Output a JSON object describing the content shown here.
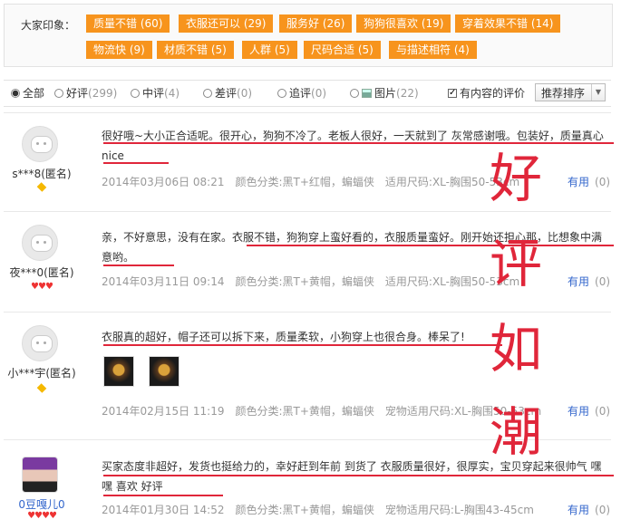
{
  "impression": {
    "label": "大家印象：",
    "tags": [
      "质量不错 (60)",
      "衣服还可以 (29)",
      "服务好 (26)",
      "狗狗很喜欢 (19)",
      "穿着效果不错 (14)",
      "物流快 (9)",
      "材质不错 (5)",
      "人群 (5)",
      "尺码合适 (5)",
      "与描述相符 (4)"
    ]
  },
  "filters": {
    "all": "全部",
    "good": "好评",
    "good_count": "(299)",
    "mid": "中评",
    "mid_count": "(4)",
    "bad": "差评",
    "bad_count": "(0)",
    "append": "追评",
    "append_count": "(0)",
    "pics": "图片",
    "pics_count": "(22)",
    "has_content": "有内容的评价",
    "sort": "推荐排序"
  },
  "reviews": [
    {
      "user": "s***8(匿名)",
      "content": "很好哦~大小正合适呢。很开心，狗狗不冷了。老板人很好，一天就到了 灰常感谢哦。包装好，质量真心nice",
      "date": "2014年03月06日 08:21",
      "color": "颜色分类:黑T+红帽，蝙蝠侠",
      "size": "适用尺码:XL-胸围50-53cm",
      "useful": "有用",
      "useful_count": "(0)"
    },
    {
      "user": "夜***0(匿名)",
      "content": "亲，不好意思，没有在家。衣服不错，狗狗穿上蛮好看的，衣服质量蛮好。刚开始还担心那，比想象中满意哟。",
      "date": "2014年03月11日 09:14",
      "color": "颜色分类:黑T+黄帽，蝙蝠侠",
      "size": "适用尺码:XL-胸围50-53cm",
      "useful": "有用",
      "useful_count": "(0)"
    },
    {
      "user": "小***宇(匿名)",
      "content": "衣服真的超好，帽子还可以拆下来，质量柔软，小狗穿上也很合身。棒呆了!",
      "date": "2014年02月15日 11:19",
      "color": "颜色分类:黑T+黄帽，蝙蝠侠",
      "size": "宠物适用尺码:XL-胸围50-53cm",
      "useful": "有用",
      "useful_count": "(0)"
    },
    {
      "user": "0豆嘎儿0",
      "content": "买家态度非超好，发货也挺给力的，幸好赶到年前 到货了 衣服质量很好，很厚实，宝贝穿起来很帅气 嘿嘿 喜欢 好评",
      "date": "2014年01月30日 14:52",
      "color": "颜色分类:黑T+黄帽，蝙蝠侠",
      "size": "宠物适用尺码:L-胸围43-45cm",
      "useful": "有用",
      "useful_count": "(0)"
    }
  ],
  "overlay": [
    "好",
    "评",
    "如",
    "潮"
  ],
  "colors": {
    "tag": "#f7941d",
    "underline": "#e0263a",
    "link": "#36c"
  }
}
